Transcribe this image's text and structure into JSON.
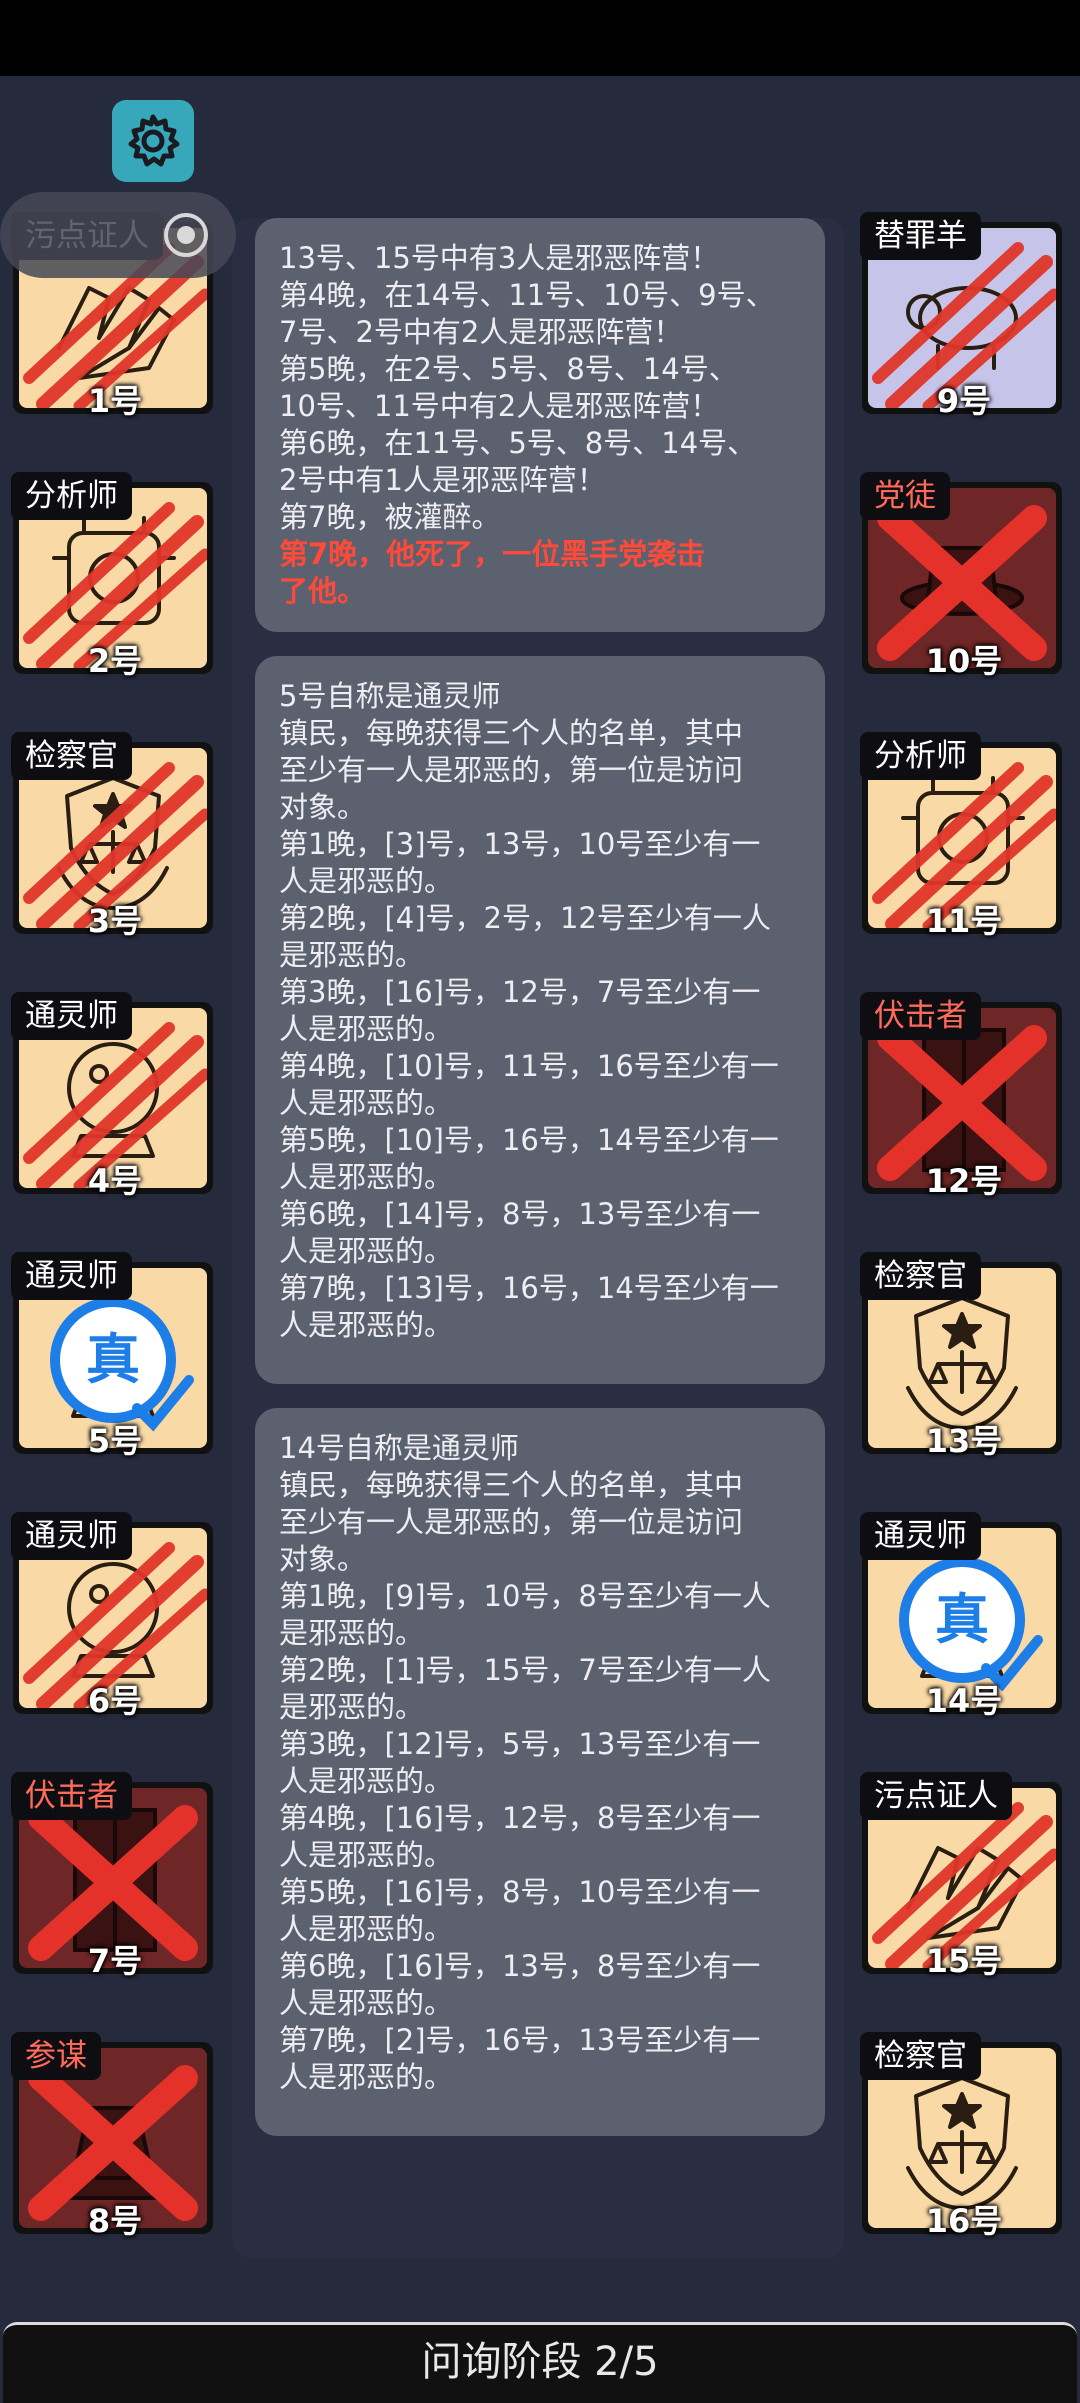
{
  "header": {
    "settings_icon": "gear-icon"
  },
  "left_players": [
    {
      "num": "1号",
      "role": "污点证人",
      "role_color": "white",
      "state": "clawed",
      "icon": "hands-icon"
    },
    {
      "num": "2号",
      "role": "分析师",
      "role_color": "white",
      "state": "clawed",
      "icon": "analyzer-icon"
    },
    {
      "num": "3号",
      "role": "检察官",
      "role_color": "white",
      "state": "clawed",
      "icon": "prosecutor-badge-icon"
    },
    {
      "num": "4号",
      "role": "通灵师",
      "role_color": "white",
      "state": "clawed",
      "icon": "crystal-ball-icon"
    },
    {
      "num": "5号",
      "role": "通灵师",
      "role_color": "white",
      "state": "true",
      "icon": "crystal-ball-icon",
      "badge": "真"
    },
    {
      "num": "6号",
      "role": "通灵师",
      "role_color": "white",
      "state": "clawed",
      "icon": "crystal-ball-icon"
    },
    {
      "num": "7号",
      "role": "伏击者",
      "role_color": "red",
      "state": "dead",
      "icon": "door-icon"
    },
    {
      "num": "8号",
      "role": "参谋",
      "role_color": "red",
      "state": "dead",
      "icon": "counselor-icon"
    }
  ],
  "right_players": [
    {
      "num": "9号",
      "role": "替罪羊",
      "role_color": "white",
      "state": "clawed",
      "icon": "sheep-icon"
    },
    {
      "num": "10号",
      "role": "党徒",
      "role_color": "red",
      "state": "dead",
      "icon": "hat-icon"
    },
    {
      "num": "11号",
      "role": "分析师",
      "role_color": "white",
      "state": "clawed",
      "icon": "analyzer-icon"
    },
    {
      "num": "12号",
      "role": "伏击者",
      "role_color": "red",
      "state": "dead",
      "icon": "door-icon"
    },
    {
      "num": "13号",
      "role": "检察官",
      "role_color": "white",
      "state": "normal",
      "icon": "prosecutor-badge-icon"
    },
    {
      "num": "14号",
      "role": "通灵师",
      "role_color": "white",
      "state": "true",
      "icon": "crystal-ball-icon",
      "badge": "真"
    },
    {
      "num": "15号",
      "role": "污点证人",
      "role_color": "white",
      "state": "clawed",
      "icon": "hands-icon"
    },
    {
      "num": "16号",
      "role": "检察官",
      "role_color": "white",
      "state": "normal",
      "icon": "prosecutor-badge-icon"
    }
  ],
  "messages": [
    {
      "lines": [
        "13号、15号中有3人是邪恶阵营！",
        "第4晚，在14号、11号、10号、9号、",
        "7号、2号中有2人是邪恶阵营！",
        "第5晚，在2号、5号、8号、14号、",
        "10号、11号中有2人是邪恶阵营！",
        "第6晚，在11号、5号、8号、14号、",
        "2号中有1人是邪恶阵营！",
        "第7晚，被灌醉。"
      ],
      "death_lines": [
        "第7晚，他死了，一位黑手党袭击",
        "了他。"
      ]
    },
    {
      "lines": [
        "5号自称是通灵师",
        "镇民，每晚获得三个人的名单，其中",
        "至少有一人是邪恶的，第一位是访问",
        "对象。",
        "第1晚，[3]号，13号，10号至少有一",
        "人是邪恶的。",
        "第2晚，[4]号，2号，12号至少有一人",
        "是邪恶的。",
        "第3晚，[16]号，12号，7号至少有一",
        "人是邪恶的。",
        "第4晚，[10]号，11号，16号至少有一",
        "人是邪恶的。",
        "第5晚，[10]号，16号，14号至少有一",
        "人是邪恶的。",
        "第6晚，[14]号，8号，13号至少有一",
        "人是邪恶的。",
        "第7晚，[13]号，16号，14号至少有一",
        "人是邪恶的。"
      ]
    },
    {
      "lines": [
        "14号自称是通灵师",
        "镇民，每晚获得三个人的名单，其中",
        "至少有一人是邪恶的，第一位是访问",
        "对象。",
        "第1晚，[9]号，10号，8号至少有一人",
        "是邪恶的。",
        "第2晚，[1]号，15号，7号至少有一人",
        "是邪恶的。",
        "第3晚，[12]号，5号，13号至少有一",
        "人是邪恶的。",
        "第4晚，[16]号，12号，8号至少有一",
        "人是邪恶的。",
        "第5晚，[16]号，8号，10号至少有一",
        "人是邪恶的。",
        "第6晚，[16]号，13号，8号至少有一",
        "人是邪恶的。",
        "第7晚，[2]号，16号，13号至少有一",
        "人是邪恶的。"
      ]
    }
  ],
  "footer": {
    "phase_label": "问询阶段 2/5"
  },
  "colors": {
    "background": "#262a3d",
    "card_alive": "#f9d9a6",
    "card_dead": "#6e2626",
    "claw": "#e0362a",
    "true_badge": "#1e7ee8",
    "settings_button": "#37a8ba"
  }
}
